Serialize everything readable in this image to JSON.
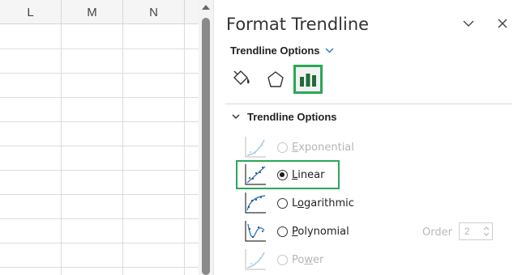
{
  "spreadsheet": {
    "columns": [
      "L",
      "M",
      "N"
    ]
  },
  "pane": {
    "title": "Format Trendline",
    "options_switch": "Trendline Options",
    "section_title": "Trendline Options",
    "tabs": [
      {
        "name": "fill-line",
        "icon": "paint-bucket-icon"
      },
      {
        "name": "effects",
        "icon": "pentagon-icon"
      },
      {
        "name": "trendline-options",
        "icon": "bar-chart-icon",
        "selected": true
      }
    ],
    "trendline_types": [
      {
        "label": "Exponential",
        "access_key": "X",
        "selected": false,
        "enabled": false
      },
      {
        "label": "Linear",
        "access_key": "L",
        "selected": true,
        "enabled": true
      },
      {
        "label": "Logarithmic",
        "access_key": "o",
        "selected": false,
        "enabled": true
      },
      {
        "label": "Polynomial",
        "access_key": "P",
        "selected": false,
        "enabled": true
      },
      {
        "label": "Power",
        "access_key": "w",
        "selected": false,
        "enabled": false
      }
    ],
    "order": {
      "label": "Order",
      "value": "2"
    }
  },
  "colors": {
    "highlight": "#2aa857",
    "accent_blue": "#2d7dd2"
  }
}
